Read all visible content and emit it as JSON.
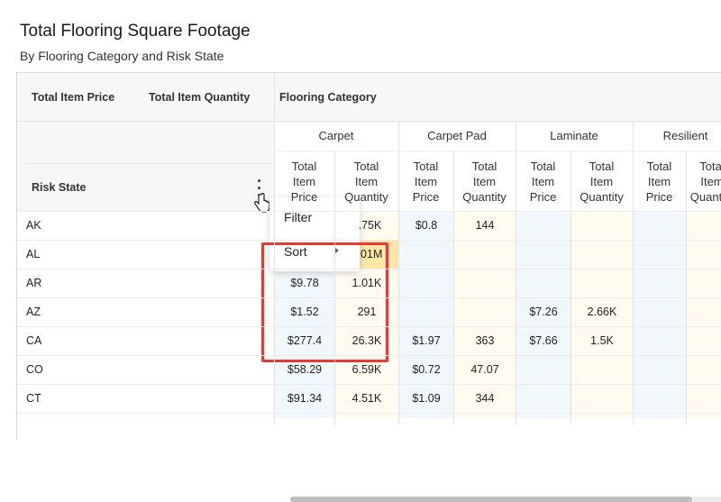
{
  "title": "Total Flooring Square Footage",
  "subtitle": "By Flooring Category and Risk State",
  "measures": [
    "Total Item Price",
    "Total Item Quantity"
  ],
  "column_dimension": "Flooring Category",
  "row_dimension": "Risk State",
  "categories": [
    "Carpet",
    "Carpet Pad",
    "Laminate",
    "Resilient"
  ],
  "subheaders": {
    "price_lines": [
      "Total",
      "Item",
      "Price"
    ],
    "quantity_lines": [
      "Total",
      "Item",
      "Quantity"
    ]
  },
  "context_menu": {
    "items": [
      "Filter",
      "Sort"
    ],
    "more_icon": "vertical-ellipsis-icon",
    "submenu_icon": "caret-right-icon",
    "cursor_icon": "hand-pointer-icon"
  },
  "rows": [
    {
      "state": "AK",
      "values": [
        "",
        "1.75K",
        "$0.8",
        "144",
        "",
        "",
        "",
        ""
      ]
    },
    {
      "state": "AL",
      "values": [
        "",
        "2.01M",
        "",
        "",
        "",
        "",
        "",
        ""
      ]
    },
    {
      "state": "AR",
      "values": [
        "$9.78",
        "1.01K",
        "",
        "",
        "",
        "",
        "",
        ""
      ]
    },
    {
      "state": "AZ",
      "values": [
        "$1.52",
        "291",
        "",
        "",
        "$7.26",
        "2.66K",
        "",
        ""
      ]
    },
    {
      "state": "CA",
      "values": [
        "$277.4",
        "26.3K",
        "$1.97",
        "363",
        "$7.66",
        "1.5K",
        "",
        ""
      ]
    },
    {
      "state": "CO",
      "values": [
        "$58.29",
        "6.59K",
        "$0.72",
        "47.07",
        "",
        "",
        "",
        ""
      ]
    },
    {
      "state": "CT",
      "values": [
        "$91.34",
        "4.51K",
        "$1.09",
        "344",
        "",
        "",
        "",
        ""
      ]
    }
  ],
  "colors": {
    "highlight_red": "#e53935",
    "header_bg": "#f7f7f7",
    "price_tint": "#f1f8fc",
    "quantity_tint": "#fffcef",
    "selected_cell": "#fde7a6"
  }
}
